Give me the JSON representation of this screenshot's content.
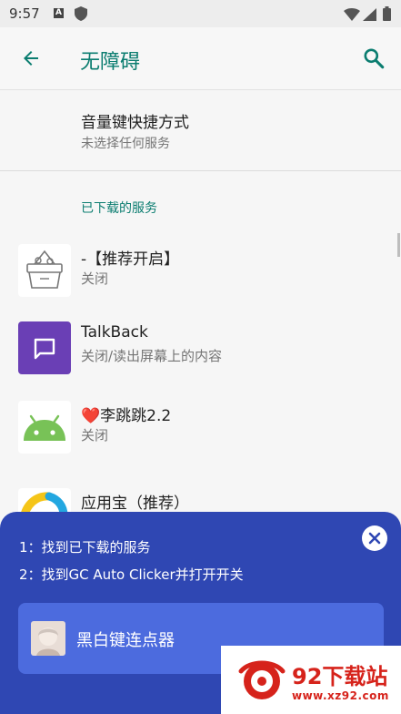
{
  "status_bar": {
    "time": "9:57",
    "a_icon": "A"
  },
  "app_bar": {
    "title": "无障碍"
  },
  "shortcut": {
    "title": "音量键快捷方式",
    "subtitle": "未选择任何服务"
  },
  "section": {
    "header": "已下载的服务"
  },
  "services": [
    {
      "title": "-【推荐开启】",
      "status": "关闭",
      "icon": "basket-icon"
    },
    {
      "title": "TalkBack",
      "status": "关闭/读出屏幕上的内容",
      "icon": "talkback-icon"
    },
    {
      "title": "❤️李跳跳2.2",
      "status": "关闭",
      "icon": "android-icon"
    },
    {
      "title": "应用宝（推荐）",
      "status": "",
      "icon": "yingyongbao-icon"
    }
  ],
  "overlay": {
    "tip1": "1：找到已下载的服务",
    "tip2": "2：找到GC Auto Clicker并打开开关",
    "app_label": "黑白键连点器"
  },
  "watermark": {
    "text": "92下载站",
    "url": "www.xz92.com"
  },
  "colors": {
    "accent": "#0b7d70",
    "overlay": "#2f47b3",
    "card": "#4c6bde",
    "talkback": "#6a3fb5",
    "android": "#78c257",
    "watermark": "#d6231b"
  }
}
